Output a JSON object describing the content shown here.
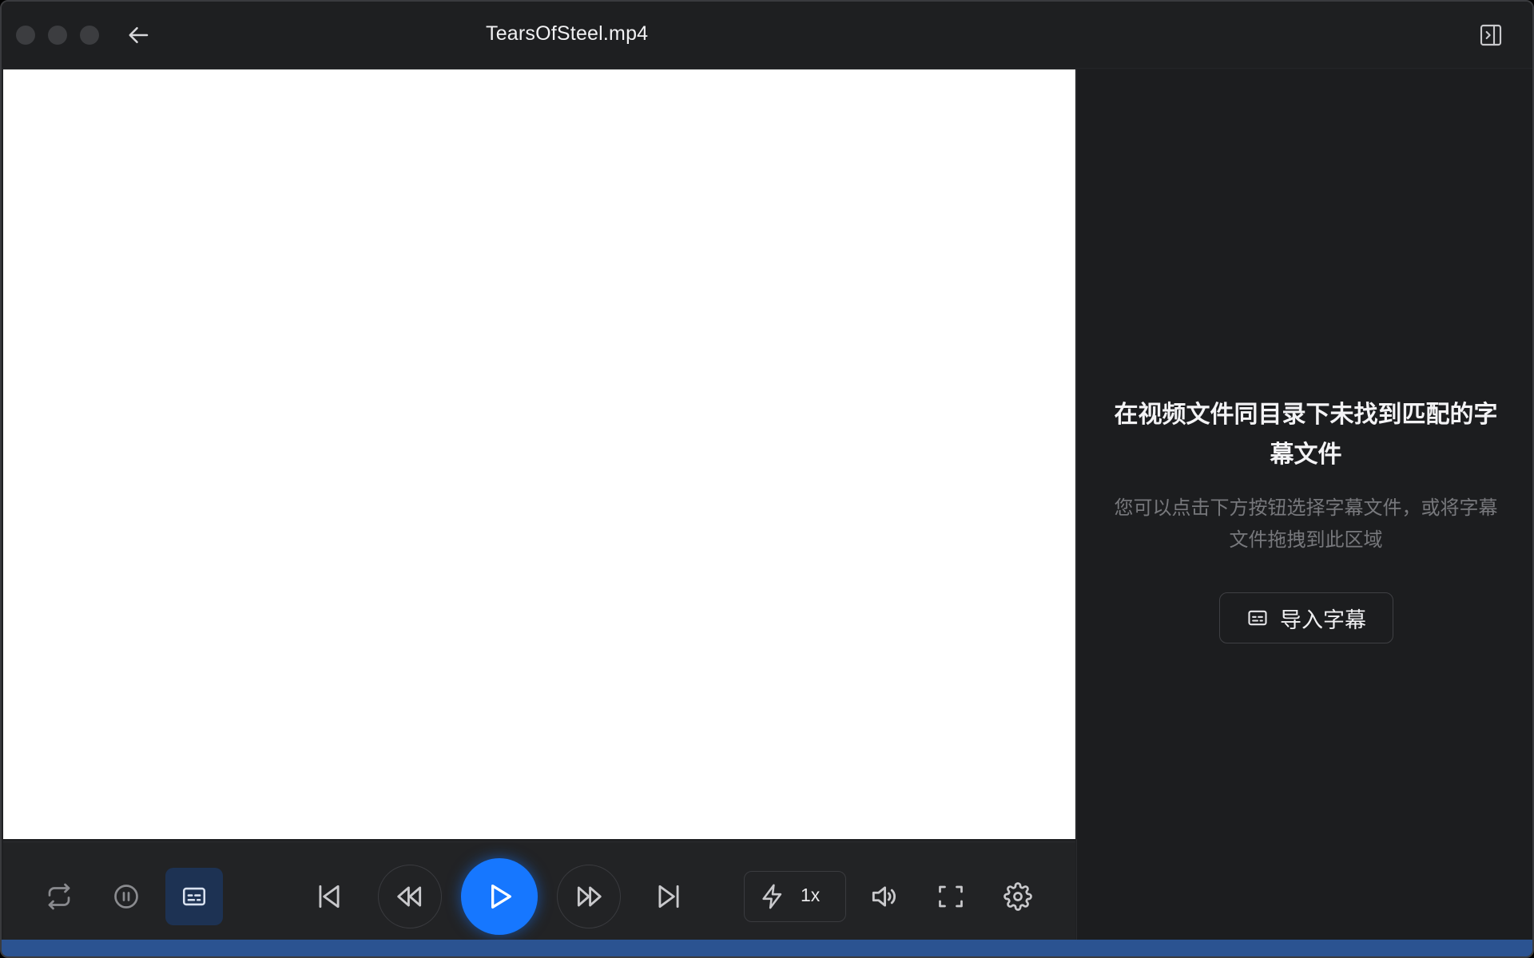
{
  "window": {
    "title": "TearsOfSteel.mp4"
  },
  "sidepanel": {
    "title": "在视频文件同目录下未找到匹配的字幕文件",
    "description": "您可以点击下方按钮选择字幕文件，或将字幕文件拖拽到此区域",
    "import_button_label": "导入字幕"
  },
  "controls": {
    "playback_rate": "1x",
    "buttons": [
      "loop-icon",
      "pause-circle-icon",
      "subtitle-icon",
      "skip-previous-icon",
      "rewind-icon",
      "play-icon",
      "fast-forward-icon",
      "skip-next-icon",
      "bolt-icon",
      "volume-icon",
      "fullscreen-icon",
      "settings-icon"
    ]
  },
  "colors": {
    "accent": "#1677ff",
    "subtitle_toggle_active": "#1d3253",
    "progress_strip": "#2b5391"
  }
}
